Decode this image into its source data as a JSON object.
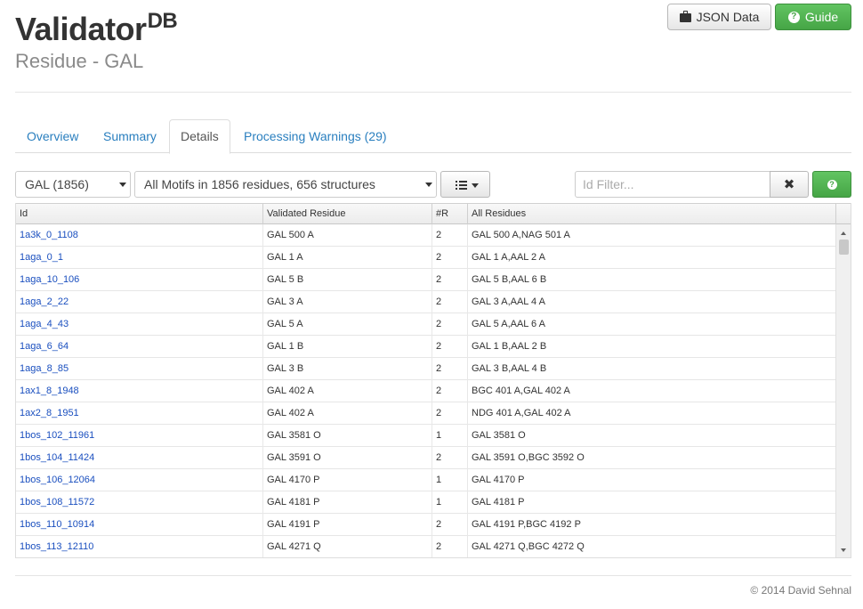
{
  "header": {
    "brand": "Validator",
    "brand_sup": "DB",
    "subtitle": "Residue - GAL",
    "json_button": "JSON Data",
    "guide_button": "Guide"
  },
  "tabs": [
    {
      "label": "Overview",
      "active": false
    },
    {
      "label": "Summary",
      "active": false
    },
    {
      "label": "Details",
      "active": true
    },
    {
      "label": "Processing Warnings (29)",
      "active": false
    }
  ],
  "controls": {
    "residue_select": "GAL (1856)",
    "motif_select": "All Motifs in 1856 residues, 656 structures",
    "filter_placeholder": "Id Filter...",
    "filter_value": ""
  },
  "table": {
    "columns": [
      "Id",
      "Validated Residue",
      "#R",
      "All Residues"
    ],
    "rows": [
      {
        "id": "1a3k_0_1108",
        "validated": "GAL 500 A",
        "r": "2",
        "all": "GAL 500 A,NAG 501 A"
      },
      {
        "id": "1aga_0_1",
        "validated": "GAL 1 A",
        "r": "2",
        "all": "GAL 1 A,AAL 2 A"
      },
      {
        "id": "1aga_10_106",
        "validated": "GAL 5 B",
        "r": "2",
        "all": "GAL 5 B,AAL 6 B"
      },
      {
        "id": "1aga_2_22",
        "validated": "GAL 3 A",
        "r": "2",
        "all": "GAL 3 A,AAL 4 A"
      },
      {
        "id": "1aga_4_43",
        "validated": "GAL 5 A",
        "r": "2",
        "all": "GAL 5 A,AAL 6 A"
      },
      {
        "id": "1aga_6_64",
        "validated": "GAL 1 B",
        "r": "2",
        "all": "GAL 1 B,AAL 2 B"
      },
      {
        "id": "1aga_8_85",
        "validated": "GAL 3 B",
        "r": "2",
        "all": "GAL 3 B,AAL 4 B"
      },
      {
        "id": "1ax1_8_1948",
        "validated": "GAL 402 A",
        "r": "2",
        "all": "BGC 401 A,GAL 402 A"
      },
      {
        "id": "1ax2_8_1951",
        "validated": "GAL 402 A",
        "r": "2",
        "all": "NDG 401 A,GAL 402 A"
      },
      {
        "id": "1bos_102_11961",
        "validated": "GAL 3581 O",
        "r": "1",
        "all": "GAL 3581 O"
      },
      {
        "id": "1bos_104_11424",
        "validated": "GAL 3591 O",
        "r": "2",
        "all": "GAL 3591 O,BGC 3592 O"
      },
      {
        "id": "1bos_106_12064",
        "validated": "GAL 4170 P",
        "r": "1",
        "all": "GAL 4170 P"
      },
      {
        "id": "1bos_108_11572",
        "validated": "GAL 4181 P",
        "r": "1",
        "all": "GAL 4181 P"
      },
      {
        "id": "1bos_110_10914",
        "validated": "GAL 4191 P",
        "r": "2",
        "all": "GAL 4191 P,BGC 4192 P"
      },
      {
        "id": "1bos_113_12110",
        "validated": "GAL 4271 Q",
        "r": "2",
        "all": "GAL 4271 Q,BGC 4272 Q"
      }
    ]
  },
  "footer": "© 2014 David Sehnal",
  "colors": {
    "link": "#1a4fbf",
    "tab_link": "#2a7fbf",
    "success": "#46a546"
  },
  "icons": {
    "json": "briefcase-icon",
    "guide": "question-circle-icon",
    "menu": "list-icon",
    "clear": "remove-icon",
    "help": "question-circle-icon"
  }
}
